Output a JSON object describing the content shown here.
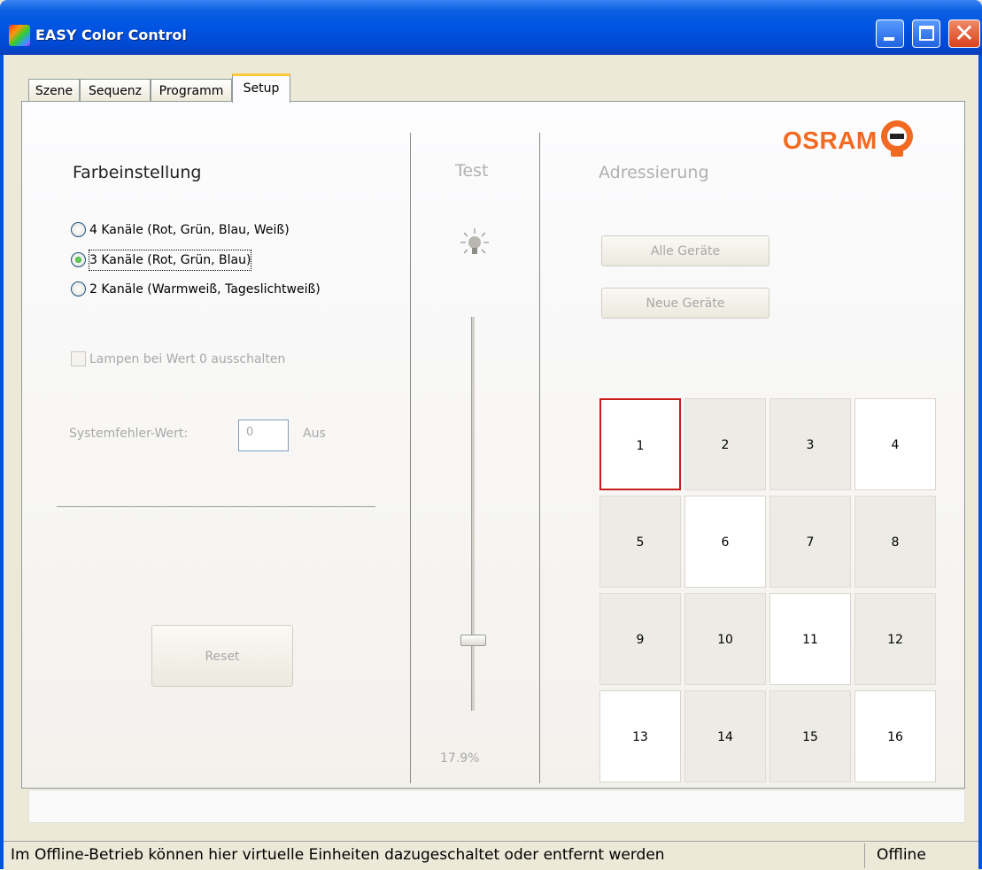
{
  "window": {
    "title": "EASY Color Control"
  },
  "tabs": [
    {
      "label": "Szene"
    },
    {
      "label": "Sequenz"
    },
    {
      "label": "Programm"
    },
    {
      "label": "Setup"
    }
  ],
  "active_tab": "Setup",
  "color_settings": {
    "heading": "Farbeinstellung",
    "options": [
      {
        "label": "4 Kanäle (Rot, Grün, Blau, Weiß)",
        "checked": false
      },
      {
        "label": "3 Kanäle (Rot, Grün, Blau)",
        "checked": true
      },
      {
        "label": "2 Kanäle (Warmweiß, Tageslichtweiß)",
        "checked": false
      }
    ],
    "lamp_off_checkbox": {
      "label": "Lampen bei Wert 0 ausschalten",
      "checked": false,
      "enabled": false
    },
    "system_error": {
      "label": "Systemfehler-Wert:",
      "value": "0",
      "unit": "Aus"
    },
    "reset_label": "Reset"
  },
  "test": {
    "heading": "Test",
    "slider_percent": 17.9,
    "slider_value_text": "17.9%"
  },
  "addressing": {
    "heading": "Adressierung",
    "all_devices_label": "Alle Geräte",
    "new_devices_label": "Neue Geräte",
    "units": [
      {
        "label": "1",
        "state": "selected"
      },
      {
        "label": "2",
        "state": "off"
      },
      {
        "label": "3",
        "state": "off"
      },
      {
        "label": "4",
        "state": "on"
      },
      {
        "label": "5",
        "state": "off"
      },
      {
        "label": "6",
        "state": "on"
      },
      {
        "label": "7",
        "state": "off"
      },
      {
        "label": "8",
        "state": "off"
      },
      {
        "label": "9",
        "state": "off"
      },
      {
        "label": "10",
        "state": "off"
      },
      {
        "label": "11",
        "state": "on"
      },
      {
        "label": "12",
        "state": "off"
      },
      {
        "label": "13",
        "state": "on"
      },
      {
        "label": "14",
        "state": "off"
      },
      {
        "label": "15",
        "state": "off"
      },
      {
        "label": "16",
        "state": "on"
      }
    ]
  },
  "brand": {
    "name": "OSRAM",
    "color": "#f26a21"
  },
  "statusbar": {
    "message": "Im Offline-Betrieb können hier virtuelle Einheiten dazugeschaltet oder entfernt werden",
    "state": "Offline"
  }
}
